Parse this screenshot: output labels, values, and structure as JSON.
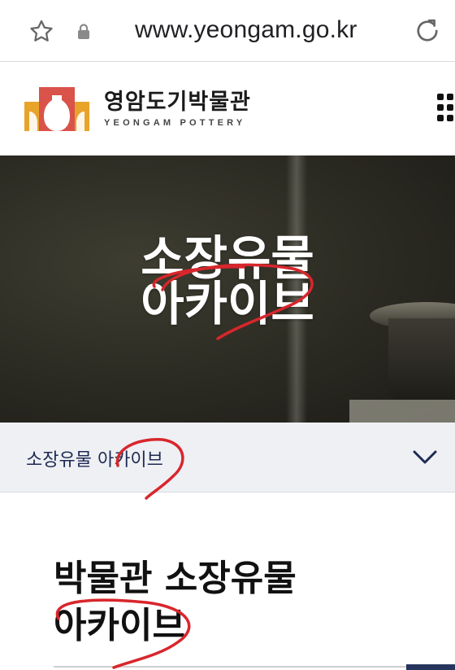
{
  "browser": {
    "url": "www.yeongam.go.kr",
    "icons": {
      "bookmark": "star-icon",
      "secure": "lock-icon",
      "reload": "reload-icon"
    }
  },
  "header": {
    "logo_name_kr": "영암도기박물관",
    "logo_name_en": "YEONGAM POTTERY",
    "menu_icon": "grid-menu-icon",
    "logo_colors": [
      "#e8a32a",
      "#d9534a"
    ]
  },
  "hero": {
    "title_line1": "소장유물",
    "title_line2": "아카이브"
  },
  "breadcrumb": {
    "label": "소장유물 아카이브",
    "chevron_icon": "chevron-down-icon"
  },
  "main": {
    "title_line1": "박물관 소장유물",
    "title_line2": "아카이브"
  },
  "colors": {
    "navy": "#1e2a52",
    "annotation_red": "#d8262c",
    "crumb_bg": "#eef0f4"
  }
}
